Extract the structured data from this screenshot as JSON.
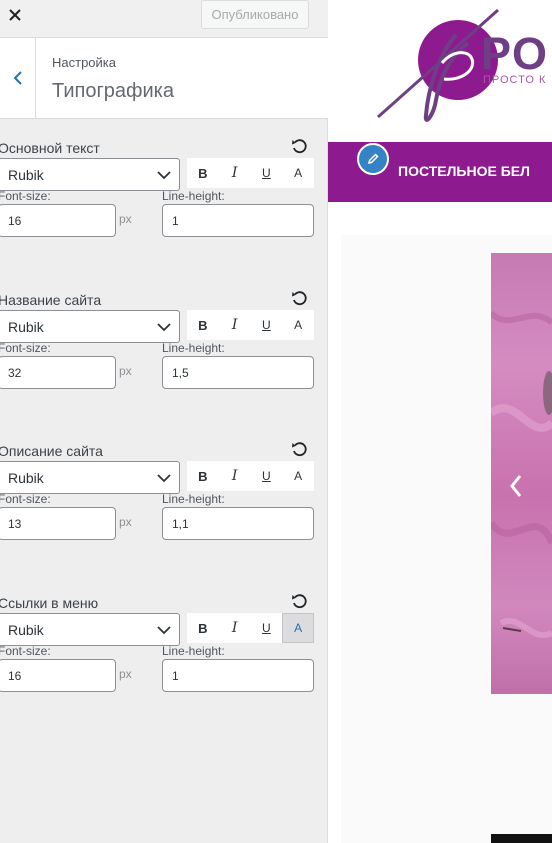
{
  "topbar": {
    "close_icon": "close-icon",
    "publish_label": "Опубликовано"
  },
  "section": {
    "back_icon": "chevron-left-icon",
    "breadcrumb": "Настройка",
    "title": "Типографика"
  },
  "groups": [
    {
      "title": "Основной текст",
      "font": "Rubik",
      "font_size": "16",
      "line_height": "1",
      "active_style": ""
    },
    {
      "title": "Название сайта",
      "font": "Rubik",
      "font_size": "32",
      "line_height": "1,5",
      "active_style": ""
    },
    {
      "title": "Описание сайта",
      "font": "Rubik",
      "font_size": "13",
      "line_height": "1,1",
      "active_style": ""
    },
    {
      "title": "Ссылки в меню",
      "font": "Rubik",
      "font_size": "16",
      "line_height": "1",
      "active_style": "A"
    }
  ],
  "labels": {
    "font_size": "Font-size:",
    "line_height": "Line-height:",
    "unit": "px"
  },
  "style_buttons": [
    "B",
    "I",
    "U",
    "A"
  ],
  "preview": {
    "logo_word": "PO",
    "logo_sub": "ПРОСТО К",
    "nav_item": "ПОСТЕЛЬНОЕ БЕЛ",
    "edit_icon": "pencil-icon",
    "slider_prev_icon": "chevron-left-icon"
  },
  "colors": {
    "brand_purple": "#8e1a8f",
    "logo_purple": "#6e3f84",
    "accent_blue": "#2271b1",
    "edit_blue": "#3582c4"
  }
}
